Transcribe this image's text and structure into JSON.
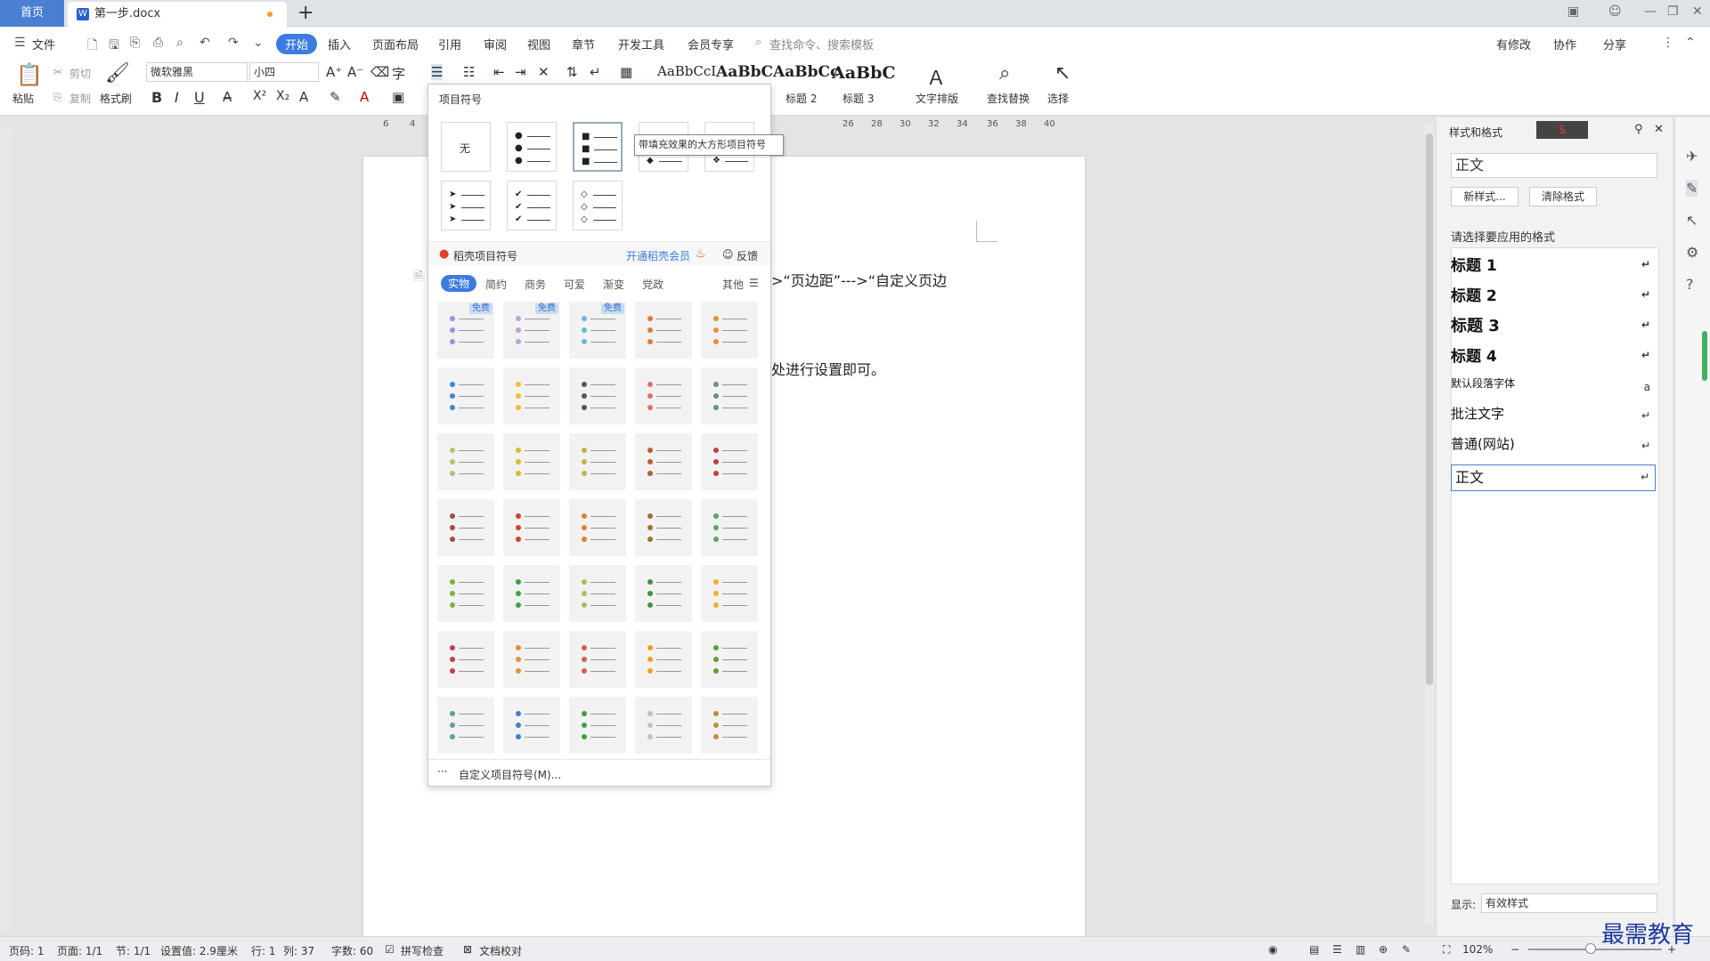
{
  "tabs": {
    "home": "首页",
    "doc": "第一步.docx"
  },
  "menu": {
    "file": "文件",
    "items": [
      "开始",
      "插入",
      "页面布局",
      "引用",
      "审阅",
      "视图",
      "章节",
      "开发工具",
      "会员专享"
    ],
    "search_placeholder": "查找命令、搜索模板",
    "right": [
      "有修改",
      "协作",
      "分享"
    ]
  },
  "ribbon": {
    "paste": "粘贴",
    "cut": "剪切",
    "copy": "复制",
    "format_painter": "格式刷",
    "font": "微软雅黑",
    "size": "小四",
    "style_previews": [
      "AaBbCcI",
      "AaBbC",
      "AaBbCc",
      "AaBbC"
    ],
    "style_labels": [
      "标题 2",
      "标题 3"
    ],
    "typeset": "文字排版",
    "find_replace": "查找替换",
    "select": "选择"
  },
  "ruler": [
    "6",
    "4",
    "26",
    "28",
    "30",
    "32",
    "34",
    "36",
    "38",
    "40"
  ],
  "document": {
    "line1": ">“页边距”--->“自定义页边",
    "line2": "处进行设置即可。"
  },
  "dropdown": {
    "title": "项目符号",
    "none": "无",
    "tooltip": "带填充效果的大方形项目符号",
    "daoke": "稻壳项目符号",
    "vip": "开通稻壳会员",
    "feedback": "反馈",
    "categories": [
      "实物",
      "简约",
      "商务",
      "可爱",
      "渐变",
      "党政"
    ],
    "other": "其他",
    "free": "免费",
    "custom": "自定义项目符号(M)..."
  },
  "panel": {
    "title": "样式和格式",
    "current": "正文",
    "new_style": "新样式...",
    "clear_format": "清除格式",
    "prompt": "请选择要应用的格式",
    "styles": [
      "标题  1",
      "标题 2",
      "标题  3",
      "标题 4",
      "默认段落字体",
      "批注文字",
      "普通(网站)",
      "正文"
    ],
    "show_label": "显示:",
    "show_value": "有效样式"
  },
  "status": {
    "page": "页码: 1",
    "pages": "页面: 1/1",
    "section": "节: 1/1",
    "setting": "设置值: 2.9厘米",
    "row": "行: 1",
    "col": "列: 37",
    "words": "字数: 60",
    "spell": "拼写检查",
    "proof": "文档校对",
    "zoom": "102%"
  },
  "watermark": "最需教育",
  "colors": {
    "accent": "#3c7be0",
    "home_tab": "#4a7fd1"
  }
}
